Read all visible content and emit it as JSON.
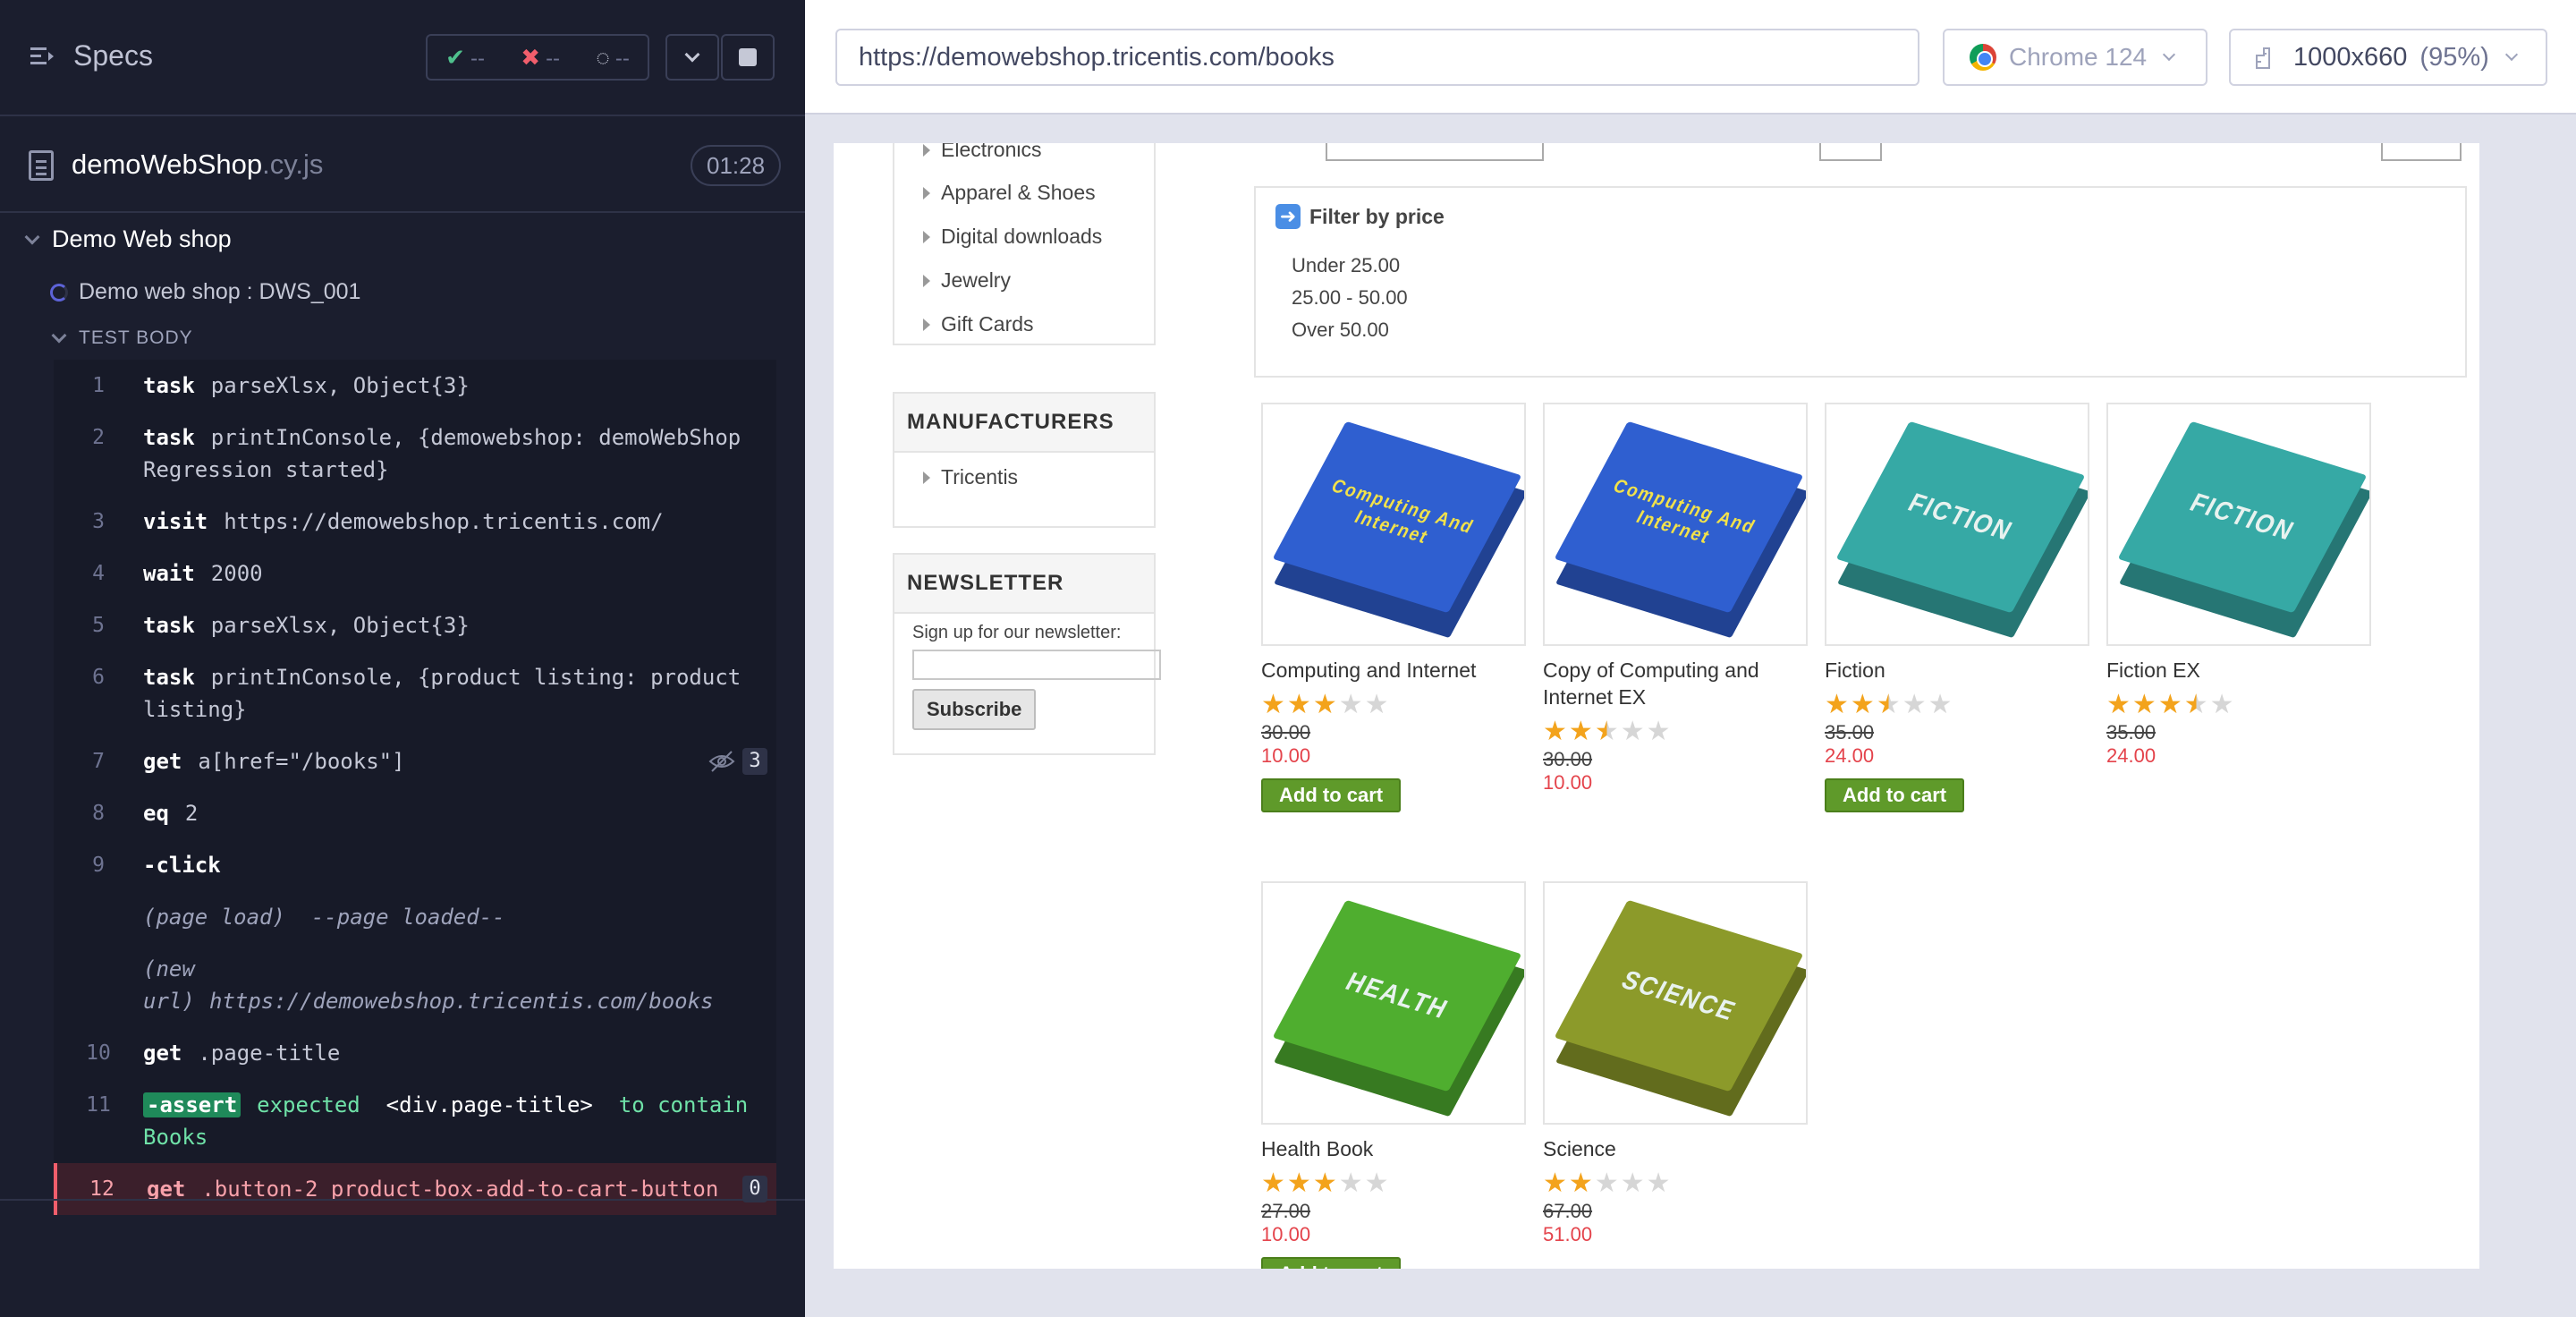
{
  "reporter": {
    "specs_label": "Specs",
    "stats": {
      "passed": "--",
      "failed": "--",
      "pending": "--"
    },
    "spec_file": {
      "name": "demoWebShop",
      "ext": ".cy.js",
      "duration": "01:28"
    },
    "suite_title": "Demo Web shop",
    "test_title": "Demo web shop : DWS_001",
    "test_body_label": "TEST BODY",
    "commands": [
      {
        "num": "1",
        "name": "task",
        "message": "parseXlsx, Object{3}"
      },
      {
        "num": "2",
        "name": "task",
        "message": "printInConsole, {demowebshop: demoWebShop Regression started}"
      },
      {
        "num": "3",
        "name": "visit",
        "message": "https://demowebshop.tricentis.com/"
      },
      {
        "num": "4",
        "name": "wait",
        "message": "2000"
      },
      {
        "num": "5",
        "name": "task",
        "message": "parseXlsx, Object{3}"
      },
      {
        "num": "6",
        "name": "task",
        "message": "printInConsole, {product listing: product listing}"
      },
      {
        "num": "7",
        "name": "get",
        "message": "a[href=\"/books\"]",
        "badge": "3"
      },
      {
        "num": "8",
        "name": "eq",
        "message": "2"
      },
      {
        "num": "9",
        "name": "-click",
        "message": ""
      },
      {
        "num": "",
        "name": "(page load)",
        "message": "--page loaded--"
      },
      {
        "num": "",
        "name": "(new url)",
        "message": "https://demowebshop.tricentis.com/books"
      },
      {
        "num": "10",
        "name": "get",
        "message": ".page-title"
      },
      {
        "num": "11",
        "name": "-assert",
        "message_parts": [
          "expected",
          "<div.page-title>",
          "to contain",
          "Books"
        ]
      },
      {
        "num": "12",
        "name": "get",
        "message": ".button-2 product-box-add-to-cart-button",
        "badge": "0"
      }
    ]
  },
  "aut": {
    "url": "https://demowebshop.tricentis.com/books",
    "browser": "Chrome 124",
    "viewport": "1000x660",
    "scale": "(95%)",
    "categories": [
      "Electronics",
      "Apparel & Shoes",
      "Digital downloads",
      "Jewelry",
      "Gift Cards"
    ],
    "manufacturers_title": "MANUFACTURERS",
    "manufacturers": [
      "Tricentis"
    ],
    "newsletter": {
      "title": "NEWSLETTER",
      "label": "Sign up for our newsletter:",
      "button": "Subscribe"
    },
    "filter": {
      "title": "Filter by price",
      "options": [
        "Under 25.00",
        "25.00 - 50.00",
        "Over 50.00"
      ]
    },
    "products": [
      {
        "name": "Computing and Internet",
        "rating": 3,
        "old_price": "30.00",
        "price": "10.00",
        "button": "Add to cart",
        "cover_text": "Computing And Internet",
        "color": "#2f5fd0"
      },
      {
        "name": "Copy of Computing and Internet EX",
        "rating": 2.5,
        "old_price": "30.00",
        "price": "10.00",
        "cover_text": "Computing And Internet",
        "color": "#2f5fd0"
      },
      {
        "name": "Fiction",
        "rating": 2.5,
        "old_price": "35.00",
        "price": "24.00",
        "button": "Add to cart",
        "cover_text": "FICTION",
        "color": "#36a9a5"
      },
      {
        "name": "Fiction EX",
        "rating": 3.5,
        "old_price": "35.00",
        "price": "24.00",
        "cover_text": "FICTION",
        "color": "#36a9a5"
      },
      {
        "name": "Health Book",
        "rating": 3,
        "old_price": "27.00",
        "price": "10.00",
        "button": "Add to cart",
        "cover_text": "HEALTH",
        "color": "#4fae2f"
      },
      {
        "name": "Science",
        "rating": 2,
        "old_price": "67.00",
        "price": "51.00",
        "cover_text": "SCIENCE",
        "color": "#8c9a2a"
      }
    ]
  }
}
